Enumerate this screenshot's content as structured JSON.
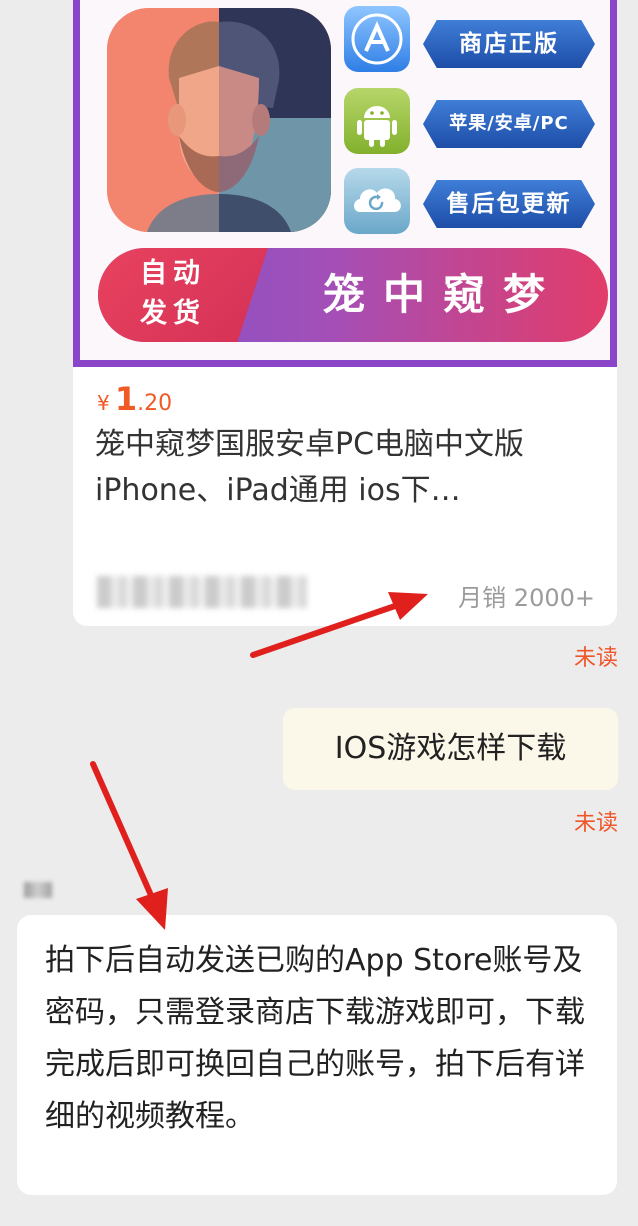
{
  "product_card": {
    "banner": {
      "tags": [
        "商店正版",
        "苹果/安卓/PC",
        "售后包更新"
      ],
      "badge_line1": "自动",
      "badge_line2": "发货",
      "title": "笼中窥梦"
    },
    "price_currency": "¥",
    "price_integer": "1",
    "price_decimal": ".20",
    "title": "笼中窥梦国服安卓PC电脑中文版 iPhone、iPad通用 ios下…",
    "sales": "月销 2000+"
  },
  "messages": [
    {
      "text": "IOS游戏怎样下载",
      "status": "未读"
    },
    {
      "text": "拍下后自动发送已购的App Store账号及密码，只需登录商店下载游戏即可，下载完成后即可换回自己的账号，拍下后有详细的视频教程。"
    }
  ],
  "card_status": "未读",
  "colors": {
    "price": "#f05a24",
    "unread": "#f0552a",
    "annotation_arrow": "#e0201c",
    "banner_border": "#8a45c9"
  },
  "icons": [
    "app-store-icon",
    "android-icon",
    "cloud-update-icon"
  ]
}
